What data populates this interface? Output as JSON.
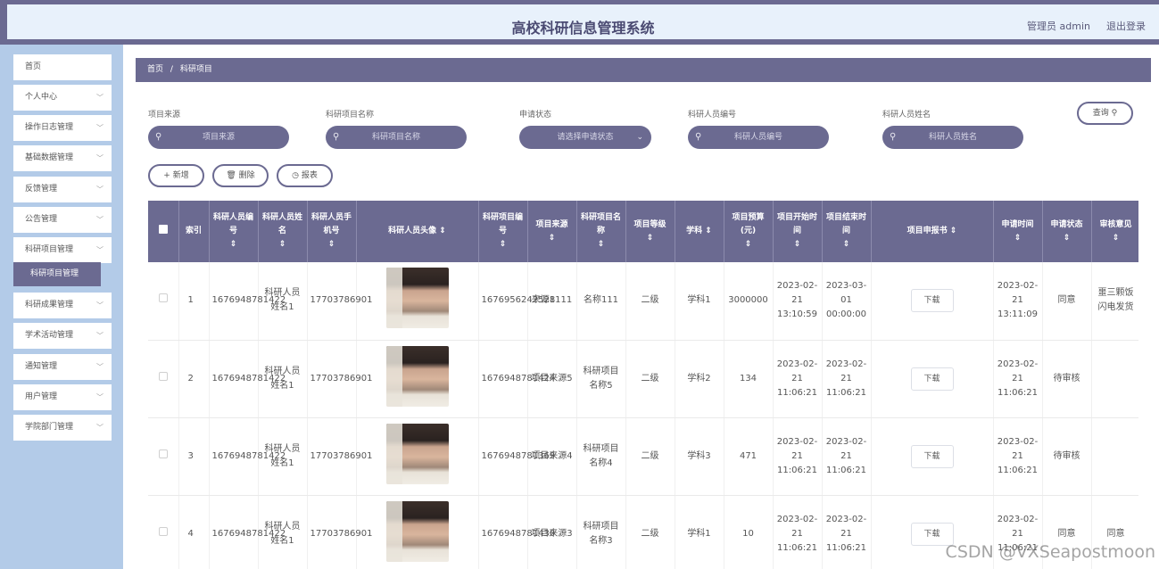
{
  "header": {
    "title": "高校科研信息管理系统",
    "user": "管理员 admin",
    "logout": "退出登录"
  },
  "sidebar": {
    "items": [
      {
        "label": "首页",
        "has_children": false
      },
      {
        "label": "个人中心",
        "has_children": true
      },
      {
        "label": "操作日志管理",
        "has_children": true
      },
      {
        "label": "基础数据管理",
        "has_children": true
      },
      {
        "label": "反馈管理",
        "has_children": true
      },
      {
        "label": "公告管理",
        "has_children": true
      },
      {
        "label": "科研项目管理",
        "has_children": true
      },
      {
        "label": "科研成果管理",
        "has_children": true
      },
      {
        "label": "学术活动管理",
        "has_children": true
      },
      {
        "label": "通知管理",
        "has_children": true
      },
      {
        "label": "用户管理",
        "has_children": true
      },
      {
        "label": "学院部门管理",
        "has_children": true
      }
    ],
    "active_sub": "科研项目管理",
    "chevron": "chevron-down-icon"
  },
  "breadcrumb": {
    "home": "首页",
    "separator": "/",
    "current": "科研项目"
  },
  "filters": [
    {
      "label": "项目来源",
      "placeholder": "项目来源",
      "type": "input"
    },
    {
      "label": "科研项目名称",
      "placeholder": "科研项目名称",
      "type": "input"
    },
    {
      "label": "申请状态",
      "placeholder": "请选择申请状态",
      "type": "select"
    },
    {
      "label": "科研人员编号",
      "placeholder": "科研人员编号",
      "type": "input"
    },
    {
      "label": "科研人员姓名",
      "placeholder": "科研人员姓名",
      "type": "input"
    }
  ],
  "actions": {
    "search": "查询",
    "add": "新增",
    "delete": "删除",
    "report": "报表"
  },
  "icons": {
    "search": "search-icon",
    "plus": "plus-icon",
    "trash": "trash-icon",
    "clock": "clock-icon",
    "sort": "sort-icon"
  },
  "table": {
    "headers": [
      "索引",
      "科研人员编号",
      "科研人员姓名",
      "科研人员手机号",
      "科研人员头像",
      "科研项目编号",
      "项目来源",
      "科研项目名称",
      "项目等级",
      "学科",
      "项目预算(元)",
      "项目开始时间",
      "项目结束时间",
      "项目申报书",
      "申请时间",
      "申请状态",
      "审核意见"
    ],
    "download_label": "下载",
    "rows": [
      {
        "index": "1",
        "staff_no": "1676948781422",
        "staff_name": "科研人员姓名1",
        "phone": "17703786901",
        "project_no": "1676956242528",
        "source": "来源1111",
        "project_name": "名称111",
        "level": "二级",
        "subject": "学科1",
        "budget": "3000000",
        "start": "2023-02-21 13:10:59",
        "end": "2023-03-01 00:00:00",
        "apply_time": "2023-02-21 13:11:09",
        "status": "同意",
        "opinion": "噩三颗饭闪电发货"
      },
      {
        "index": "2",
        "staff_no": "1676948781422",
        "staff_name": "科研人员姓名1",
        "phone": "17703786901",
        "project_no": "1676948781424",
        "source": "项目来源5",
        "project_name": "科研项目名称5",
        "level": "二级",
        "subject": "学科2",
        "budget": "134",
        "start": "2023-02-21 11:06:21",
        "end": "2023-02-21 11:06:21",
        "apply_time": "2023-02-21 11:06:21",
        "status": "待审核",
        "opinion": ""
      },
      {
        "index": "3",
        "staff_no": "1676948781422",
        "staff_name": "科研人员姓名1",
        "phone": "17703786901",
        "project_no": "1676948781369",
        "source": "项目来源4",
        "project_name": "科研项目名称4",
        "level": "二级",
        "subject": "学科3",
        "budget": "471",
        "start": "2023-02-21 11:06:21",
        "end": "2023-02-21 11:06:21",
        "apply_time": "2023-02-21 11:06:21",
        "status": "待审核",
        "opinion": ""
      },
      {
        "index": "4",
        "staff_no": "1676948781422",
        "staff_name": "科研人员姓名1",
        "phone": "17703786901",
        "project_no": "1676948781430",
        "source": "项目来源3",
        "project_name": "科研项目名称3",
        "level": "二级",
        "subject": "学科1",
        "budget": "10",
        "start": "2023-02-21 11:06:21",
        "end": "2023-02-21 11:06:21",
        "apply_time": "2023-02-21 11:06:21",
        "status": "同意",
        "opinion": "同意"
      }
    ]
  },
  "watermark": "CSDN @VXSeapostmoon",
  "colors": {
    "primary": "#6b6a91",
    "sidebar_bg": "#b3cbe8",
    "header_bg": "#e8f1fb"
  }
}
